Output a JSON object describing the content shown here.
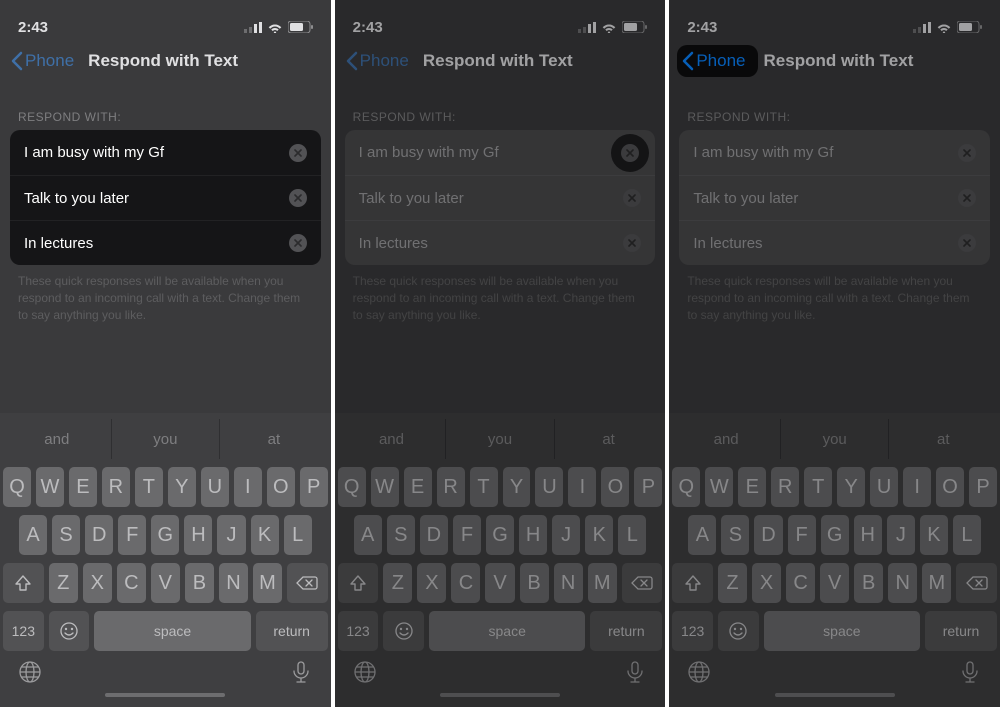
{
  "status": {
    "time": "2:43"
  },
  "nav": {
    "back": "Phone",
    "title": "Respond with Text"
  },
  "section": {
    "header": "RESPOND WITH:"
  },
  "responses": [
    {
      "text": "I am busy with my Gf"
    },
    {
      "text": "Talk to you later"
    },
    {
      "text": "In lectures"
    }
  ],
  "description": "These quick responses will be available when you respond to an incoming call with a text. Change them to say anything you like.",
  "keyboard": {
    "suggestions": [
      "and",
      "you",
      "at"
    ],
    "row1": [
      "Q",
      "W",
      "E",
      "R",
      "T",
      "Y",
      "U",
      "I",
      "O",
      "P"
    ],
    "row2": [
      "A",
      "S",
      "D",
      "F",
      "G",
      "H",
      "J",
      "K",
      "L"
    ],
    "row3": [
      "Z",
      "X",
      "C",
      "V",
      "B",
      "N",
      "M"
    ],
    "numKey": "123",
    "space": "space",
    "return": "return"
  }
}
